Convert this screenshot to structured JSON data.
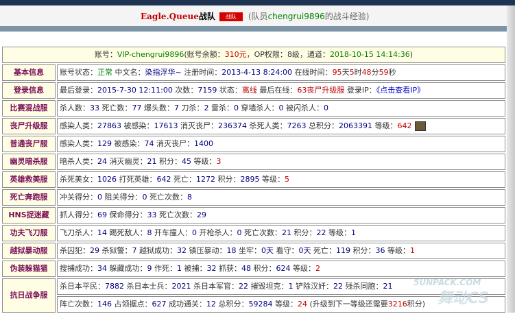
{
  "header": {
    "team_name": "Eagle.Queue",
    "team_suffix": "战队",
    "badge": "战队",
    "member_prefix": "(队员",
    "member_name": "chengrui9896",
    "member_suffix": "的战斗经验)"
  },
  "account": {
    "label": "账号：",
    "id": "VIP-chengrui9896",
    "balance_label": "(账号余额：",
    "balance": "310元",
    "perm_label": "，OP权限：",
    "perm": "8级",
    "channel_label": "，通道：",
    "datetime": "2018-10-15 14:14:36",
    "close": ")"
  },
  "rows": {
    "basic": {
      "label": "基本信息",
      "status_label": "账号状态：",
      "status": "正常",
      "name_label": "中文名：",
      "name": "染指浮华~",
      "reg_label": "注册时间：",
      "reg": "2013-4-13 8:24:00",
      "online_label": "在线时间：",
      "days": "95",
      "days_u": "天",
      "hours": "5",
      "hours_u": "时",
      "mins": "48",
      "mins_u": "分",
      "secs": "59",
      "secs_u": "秒"
    },
    "login": {
      "label": "登录信息",
      "last_label": "最后登录：",
      "last": "2015-7-30 12:11:00",
      "count_label": "次数：",
      "count": "7159",
      "state_label": "状态：",
      "state": "离线",
      "lastonline_label": "最后在线：",
      "lastonline": "63丧尸升级服",
      "ip_label": "登录IP：",
      "ip": "《点击查看IP》"
    },
    "mix": {
      "label": "比赛混战服",
      "t1": "杀人数：",
      "v1": "33",
      "t2": "死亡数：",
      "v2": "77",
      "t3": "爆头数：",
      "v3": "7",
      "t4": "刀杀：",
      "v4": "2",
      "t5": "雷杀：",
      "v5": "0",
      "t6": "穿墙杀人：",
      "v6": "0",
      "t7": "被闪杀人：",
      "v7": "0"
    },
    "zombie_up": {
      "label": "丧尸升级服",
      "t1": "感染人类：",
      "v1": "27863",
      "t2": "被感染：",
      "v2": "17613",
      "t3": "消灭丧尸：",
      "v3": "236374",
      "t4": "杀死人类：",
      "v4": "7263",
      "t5": "总积分：",
      "v5": "2063391",
      "t6": "等级：",
      "v6": "642"
    },
    "zombie_normal": {
      "label": "普通丧尸服",
      "t1": "感染人类：",
      "v1": "129",
      "t2": "被感染：",
      "v2": "74",
      "t3": "消灭丧尸：",
      "v3": "1400"
    },
    "ghost": {
      "label": "幽灵暗杀服",
      "t1": "暗杀人类：",
      "v1": "24",
      "t2": "消灭幽灵：",
      "v2": "21",
      "t3": "积分：",
      "v3": "45",
      "t4": "等级：",
      "v4": "3"
    },
    "hero": {
      "label": "英雄救美服",
      "t1": "杀死美女：",
      "v1": "1026",
      "t2": "打死英雄：",
      "v2": "642",
      "t3": "死亡：",
      "v3": "1272",
      "t4": "积分：",
      "v4": "2895",
      "t5": "等级：",
      "v5": "5"
    },
    "run": {
      "label": "死亡奔跑服",
      "t1": "冲关得分：",
      "v1": "0",
      "t2": "阻关得分：",
      "v2": "0",
      "t3": "死亡次数：",
      "v3": "8"
    },
    "hns": {
      "label": "HNS捉迷藏",
      "t1": "抓人得分：",
      "v1": "69",
      "t2": "保命得分：",
      "v2": "33",
      "t3": "死亡次数：",
      "v3": "29"
    },
    "knife": {
      "label": "功夫飞刀服",
      "t1": "飞刀杀人：",
      "v1": "14",
      "t2": "踢死敌人：",
      "v2": "8",
      "t3": "开车撞人：",
      "v3": "0",
      "t4": "开枪杀人：",
      "v4": "0",
      "t5": "死亡次数：",
      "v5": "21",
      "t6": "积分：",
      "v6": "22",
      "t7": "等级：",
      "v7": "1"
    },
    "jail": {
      "label": "越狱暴动服",
      "t1": "杀囚犯：",
      "v1": "29",
      "t2": "杀狱警：",
      "v2": "7",
      "t3": "越狱成功：",
      "v3": "32",
      "t4": "镇压暴动：",
      "v4": "18",
      "t5": "坐牢：",
      "v5": "0天",
      "t6": "看守：",
      "v6": "0天",
      "t7": "死亡：",
      "v7": "119",
      "t8": "积分：",
      "v8": "36",
      "t9": "等级：",
      "v9": "1"
    },
    "disguise": {
      "label": "伪装躲猫猫",
      "t1": "搜捕成功：",
      "v1": "34",
      "t2": "躲藏成功：",
      "v2": "9",
      "t3": "作死：",
      "v3": "1",
      "t4": "被捕：",
      "v4": "32",
      "t5": "抓获：",
      "v5": "48",
      "t6": "积分：",
      "v6": "624",
      "t7": "等级：",
      "v7": "2"
    },
    "war": {
      "label": "抗日战争服",
      "a1": "杀日本平民：",
      "av1": "7882",
      "a2": "杀日本士兵：",
      "av2": "2021",
      "a3": "杀日本军官：",
      "av3": "22",
      "a4": "摧毁坦克：",
      "av4": "1",
      "a5": "铲除汉奸：",
      "av5": "22",
      "a6": "残杀同胞：",
      "av6": "21",
      "b1": "阵亡次数：",
      "bv1": "146",
      "b2": "占领据点：",
      "bv2": "627",
      "b3": "成功通关：",
      "bv3": "12",
      "b4": "总积分：",
      "bv4": "59284",
      "b5": "等级：",
      "bv5": "24",
      "b6": "(升级到下一等级还需要",
      "bv6": "3216",
      "b7": "积分)"
    }
  },
  "watermark": {
    "line1": "5UNPACK.COM",
    "line2": "舞动CS"
  },
  "colors": {
    "label_text": "#7a0f5a",
    "label_bg": "#fffde4",
    "value_blue": "#000080",
    "value_red": "#c00000",
    "value_green": "#008000"
  }
}
